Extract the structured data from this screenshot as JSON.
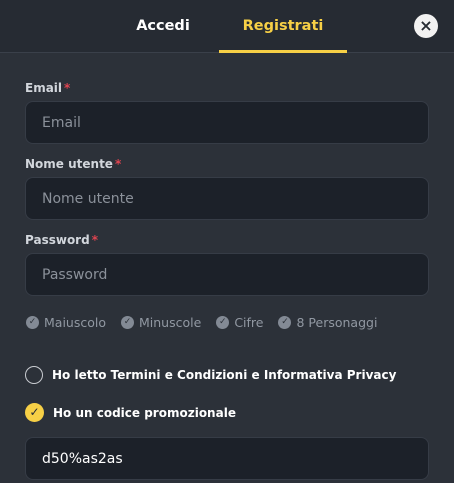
{
  "tabs": {
    "login": "Accedi",
    "register": "Registrati"
  },
  "close_icon": "×",
  "form": {
    "email": {
      "label": "Email",
      "required_mark": "*",
      "placeholder": "Email"
    },
    "username": {
      "label": "Nome utente",
      "required_mark": "*",
      "placeholder": "Nome utente"
    },
    "password": {
      "label": "Password",
      "required_mark": "*",
      "placeholder": "Password"
    },
    "rules": [
      {
        "label": "Maiuscolo",
        "icon": "check-circle-icon"
      },
      {
        "label": "Minuscole",
        "icon": "check-circle-icon"
      },
      {
        "label": "Cifre",
        "icon": "check-circle-icon"
      },
      {
        "label": "8 Personaggi",
        "icon": "check-circle-icon"
      }
    ],
    "terms": {
      "label": "Ho letto Termini e Condizioni e Informativa Privacy",
      "checked": false
    },
    "promo": {
      "label": "Ho un codice promozionale",
      "checked": true,
      "value": "d50%as2as"
    }
  },
  "colors": {
    "accent": "#f7d046",
    "required": "#e04450",
    "background": "#2c3139",
    "input_bg": "#1c2129"
  }
}
